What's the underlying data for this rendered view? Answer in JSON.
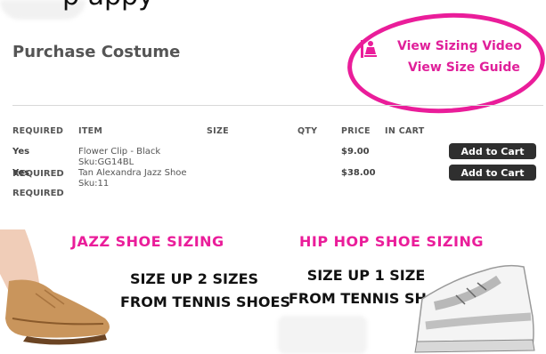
{
  "header": {
    "partial_text": "p                                          appy",
    "title": "Purchase Costume"
  },
  "links": {
    "sizing_video": "View Sizing Video",
    "size_guide": "View Size Guide"
  },
  "table": {
    "columns": [
      "REQUIRED",
      "ITEM",
      "SIZE",
      "QTY",
      "PRICE",
      "IN CART"
    ],
    "rows": [
      {
        "required": "Yes",
        "item_name": "Flower Clip - Black",
        "sku": "Sku:GG14BL",
        "price": "$9.00",
        "button": "Add to Cart",
        "required_label": "REQUIRED"
      },
      {
        "required": "Yes",
        "item_name": "Tan Alexandra Jazz Shoe",
        "sku": "Sku:11",
        "price": "$38.00",
        "button": "Add to Cart",
        "required_label": "REQUIRED"
      }
    ]
  },
  "promo": {
    "jazz": {
      "heading": "JAZZ SHOE SIZING",
      "line1": "SIZE UP 2 SIZES",
      "line2": "FROM TENNIS SHOES"
    },
    "hiphop": {
      "heading": "HIP HOP SHOE SIZING",
      "line1": "SIZE UP 1 SIZE",
      "line2": "FROM TENNIS SHOES"
    }
  },
  "colors": {
    "accent": "#ea1d9a",
    "button": "#2f2f2f"
  }
}
